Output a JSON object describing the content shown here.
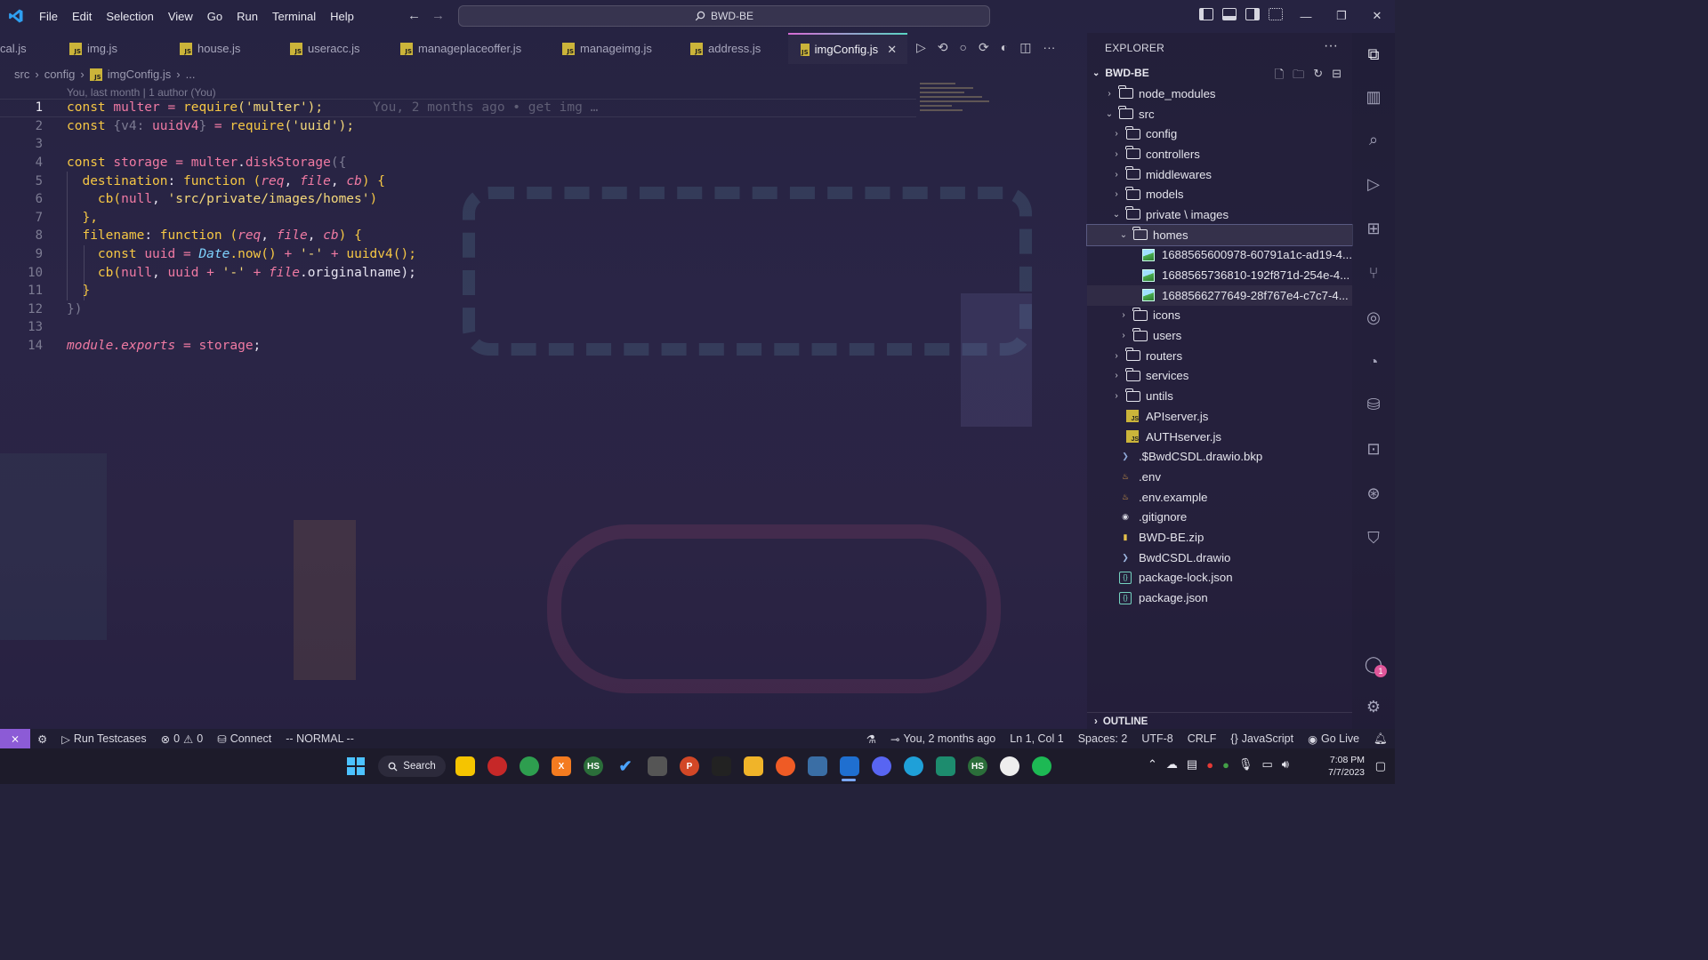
{
  "menu": [
    "File",
    "Edit",
    "Selection",
    "View",
    "Go",
    "Run",
    "Terminal",
    "Help"
  ],
  "command_center": "BWD-BE",
  "tabs": [
    {
      "label": "cal.js",
      "active": false,
      "icon": "js-file-icon"
    },
    {
      "label": "img.js",
      "active": false,
      "icon": "js-file-icon"
    },
    {
      "label": "house.js",
      "active": false,
      "icon": "js-file-icon"
    },
    {
      "label": "useracc.js",
      "active": false,
      "icon": "js-file-icon"
    },
    {
      "label": "manageplaceoffer.js",
      "active": false,
      "icon": "js-file-icon"
    },
    {
      "label": "manageimg.js",
      "active": false,
      "icon": "js-file-icon"
    },
    {
      "label": "address.js",
      "active": false,
      "icon": "js-file-icon"
    },
    {
      "label": "imgConfig.js",
      "active": true,
      "icon": "js-file-icon"
    }
  ],
  "breadcrumb": {
    "p1": "src",
    "p2": "config",
    "p3": "imgConfig.js",
    "p4": "..."
  },
  "blame_header": "You, last month | 1 author (You)",
  "ghost_blame": "You, 2 months ago • get img …",
  "code": {
    "line_numbers": [
      "1",
      "2",
      "3",
      "4",
      "5",
      "6",
      "7",
      "8",
      "9",
      "10",
      "11",
      "12",
      "13",
      "14"
    ],
    "l1": {
      "a": "const",
      "b": "multer",
      "c": "=",
      "d": "require",
      "e": "('",
      "f": "multer",
      "g": "');"
    },
    "l2": {
      "a": "const",
      "b": "{v4:",
      "c": "uuidv4",
      "d": "}",
      "e": "=",
      "f": "require",
      "g": "('",
      "h": "uuid",
      "i": "');"
    },
    "l4": {
      "a": "const",
      "b": "storage",
      "c": "=",
      "d": "multer",
      "e": ".",
      "f": "diskStorage",
      "g": "({"
    },
    "l5": {
      "a": "destination",
      "b": ":",
      "c": "function",
      "d": "(",
      "e": "req",
      "f": ",",
      "g": "file",
      "h": ",",
      "i": "cb",
      "j": ") {"
    },
    "l6": {
      "a": "cb(",
      "b": "null",
      "c": ",",
      "d": "'src/private/images/homes'",
      "e": ")"
    },
    "l7": {
      "a": "},"
    },
    "l8": {
      "a": "filename",
      "b": ":",
      "c": "function",
      "d": "(",
      "e": "req",
      "f": ",",
      "g": "file",
      "h": ",",
      "i": "cb",
      "j": ") {"
    },
    "l9": {
      "a": "const",
      "b": "uuid",
      "c": "=",
      "d": "Date",
      "e": ".now()",
      "f": "+",
      "g": "'-'",
      "h": "+",
      "i": "uuidv4",
      "j": "();"
    },
    "l10": {
      "a": "cb(",
      "b": "null",
      "c": ",",
      "d": "uuid",
      "e": "+",
      "f": "'-'",
      "g": "+",
      "h": "file",
      "i": ".originalname);"
    },
    "l11": {
      "a": "}"
    },
    "l12": {
      "a": "})"
    },
    "l14": {
      "a": "module",
      "b": ".exports",
      "c": "=",
      "d": "storage",
      "e": ";"
    }
  },
  "explorer": {
    "title": "EXPLORER",
    "project": "BWD-BE",
    "tree": [
      {
        "label": "node_modules",
        "type": "folder",
        "depth": 1,
        "open": false
      },
      {
        "label": "src",
        "type": "folder",
        "depth": 1,
        "open": true
      },
      {
        "label": "config",
        "type": "folder",
        "depth": 2,
        "open": false
      },
      {
        "label": "controllers",
        "type": "folder",
        "depth": 2,
        "open": false
      },
      {
        "label": "middlewares",
        "type": "folder",
        "depth": 2,
        "open": false
      },
      {
        "label": "models",
        "type": "folder",
        "depth": 2,
        "open": false
      },
      {
        "label": "private \\ images",
        "type": "folder",
        "depth": 2,
        "open": true
      },
      {
        "label": "homes",
        "type": "folder",
        "depth": 3,
        "open": true,
        "selected": true
      },
      {
        "label": "1688565600978-60791a1c-ad19-4...",
        "type": "image",
        "depth": 4
      },
      {
        "label": "1688565736810-192f871d-254e-4...",
        "type": "image",
        "depth": 4
      },
      {
        "label": "1688566277649-28f767e4-c7c7-4...",
        "type": "image",
        "depth": 4
      },
      {
        "label": "icons",
        "type": "folder",
        "depth": 3,
        "open": false
      },
      {
        "label": "users",
        "type": "folder",
        "depth": 3,
        "open": false
      },
      {
        "label": "routers",
        "type": "folder",
        "depth": 2,
        "open": false
      },
      {
        "label": "services",
        "type": "folder",
        "depth": 2,
        "open": false
      },
      {
        "label": "untils",
        "type": "folder",
        "depth": 2,
        "open": false
      },
      {
        "label": "APIserver.js",
        "type": "js",
        "depth": 2
      },
      {
        "label": "AUTHserver.js",
        "type": "js",
        "depth": 2
      },
      {
        "label": ".$BwdCSDL.drawio.bkp",
        "type": "bkp",
        "depth": 1
      },
      {
        "label": ".env",
        "type": "env",
        "depth": 1
      },
      {
        "label": ".env.example",
        "type": "env",
        "depth": 1
      },
      {
        "label": ".gitignore",
        "type": "git",
        "depth": 1
      },
      {
        "label": "BWD-BE.zip",
        "type": "zip",
        "depth": 1
      },
      {
        "label": "BwdCSDL.drawio",
        "type": "drawio",
        "depth": 1
      },
      {
        "label": "package-lock.json",
        "type": "json",
        "depth": 1
      },
      {
        "label": "package.json",
        "type": "json",
        "depth": 1
      }
    ],
    "outline": "OUTLINE"
  },
  "activity_badge": "1",
  "status": {
    "run_testcases": "Run Testcases",
    "errors": "0",
    "warnings": "0",
    "connect": "Connect",
    "mode": "-- NORMAL --",
    "blame": "You, 2 months ago",
    "position": "Ln 1, Col 1",
    "spaces": "Spaces: 2",
    "encoding": "UTF-8",
    "eol": "CRLF",
    "language": "JavaScript",
    "golive": "Go Live"
  },
  "taskbar": {
    "search": "Search",
    "time": "7:08 PM",
    "date": "7/7/2023"
  },
  "colors": {
    "accent": "#8c5bd6",
    "keyword": "#f6c744",
    "variable": "#f07aa3",
    "js_badge": "#cbb43a"
  }
}
